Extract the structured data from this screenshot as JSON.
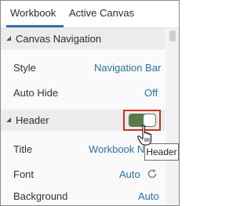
{
  "tabs": [
    {
      "label": "Workbook",
      "active": true
    },
    {
      "label": "Active Canvas",
      "active": false
    }
  ],
  "sections": {
    "canvas_navigation": {
      "title": "Canvas Navigation",
      "rows": [
        {
          "label": "Style",
          "value": "Navigation Bar"
        },
        {
          "label": "Auto Hide",
          "value": "Off"
        }
      ]
    },
    "header": {
      "title": "Header",
      "toggle_on": true,
      "tooltip": "Header",
      "rows": [
        {
          "label": "Title",
          "value": "Workbook N"
        },
        {
          "label": "Font",
          "value": "Auto"
        },
        {
          "label": "Background",
          "value": "Auto"
        }
      ]
    }
  },
  "icons": {
    "collapse": "caret-down-icon",
    "reset": "refresh-icon",
    "pointer": "hand-cursor-icon"
  },
  "colors": {
    "accent": "#3b6ea6",
    "link": "#2d6ea3",
    "toggle_on": "#5d7a4c",
    "highlight_outline": "#c8321e"
  }
}
